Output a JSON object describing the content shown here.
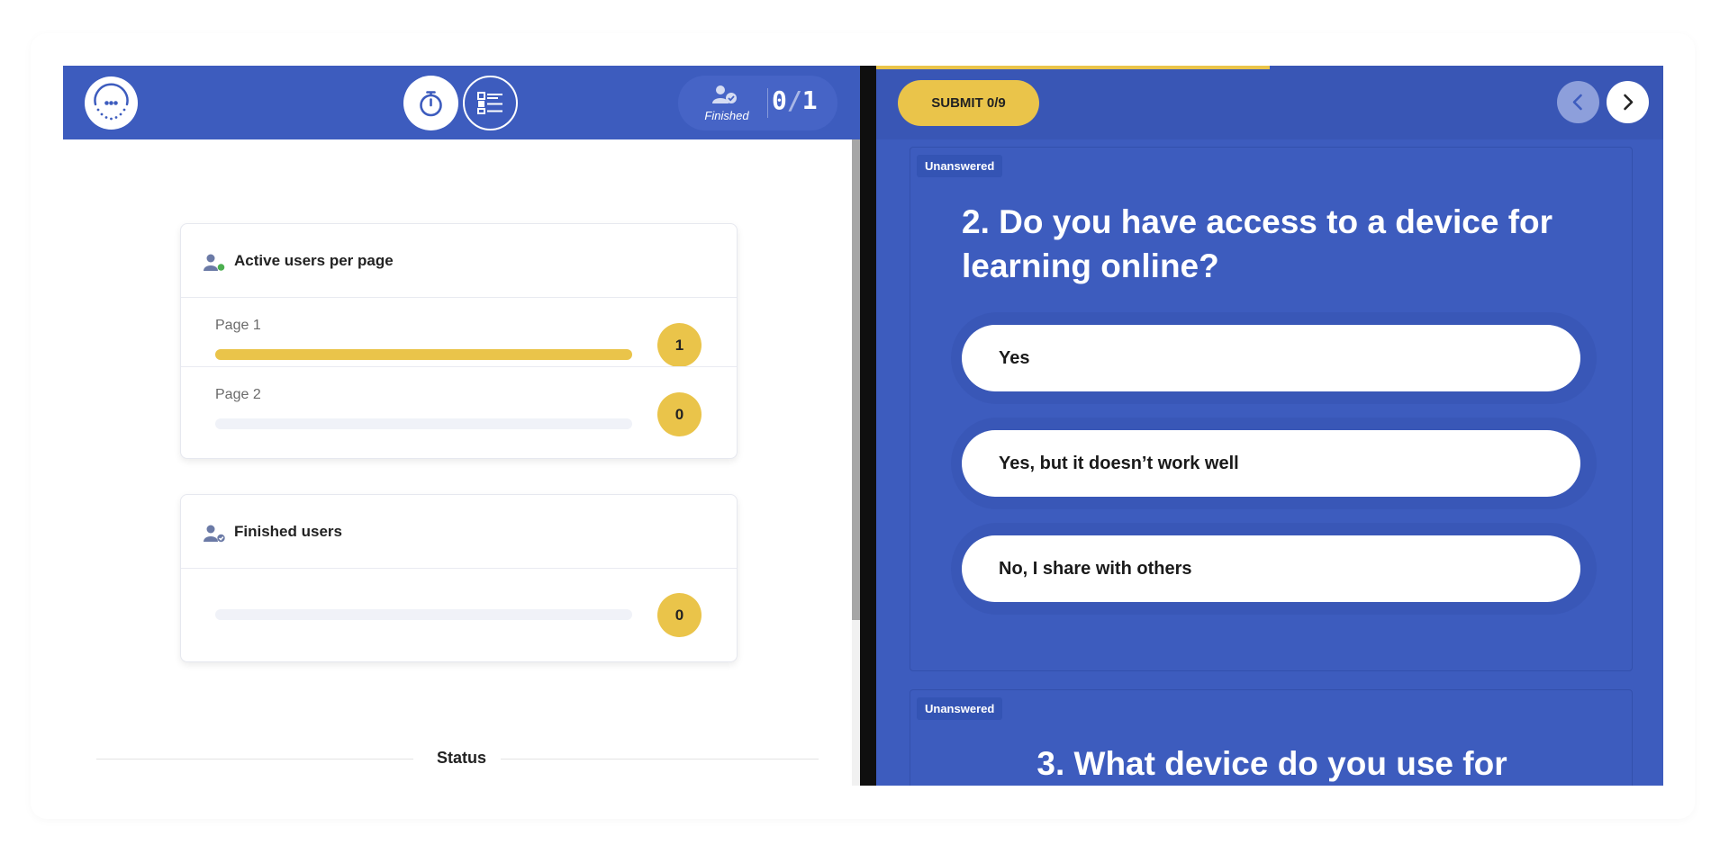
{
  "left_panel": {
    "header": {
      "counter": {
        "current": "0",
        "separator": "/",
        "total": "1"
      },
      "finished_label": "Finished"
    },
    "active_users_card": {
      "title": "Active users per page",
      "rows": [
        {
          "label": "Page 1",
          "count": "1",
          "fill_fraction": 1.0
        },
        {
          "label": "Page 2",
          "count": "0",
          "fill_fraction": 0.0
        }
      ]
    },
    "finished_users_card": {
      "title": "Finished users",
      "count": "0",
      "fill_fraction": 0.0
    },
    "status_heading": "Status"
  },
  "right_panel": {
    "submit_label": "SUBMIT 0/9",
    "top_progress_fraction": 0.5,
    "questions": [
      {
        "status": "Unanswered",
        "title": "2. Do you have access to a device for learning online?",
        "options": [
          "Yes",
          "Yes, but it doesn’t work well",
          "No, I share with others"
        ]
      },
      {
        "status": "Unanswered",
        "title": "3. What device do you use for"
      }
    ]
  },
  "colors": {
    "primary_blue": "#3d5cbe",
    "header_blue": "#3956b5",
    "accent_yellow": "#eac44a",
    "online_green": "#4caf50"
  },
  "icons": [
    "logo-icon",
    "timer-icon",
    "list-icon",
    "finished-user-icon",
    "active-user-icon",
    "chevron-left-icon",
    "chevron-right-icon"
  ]
}
